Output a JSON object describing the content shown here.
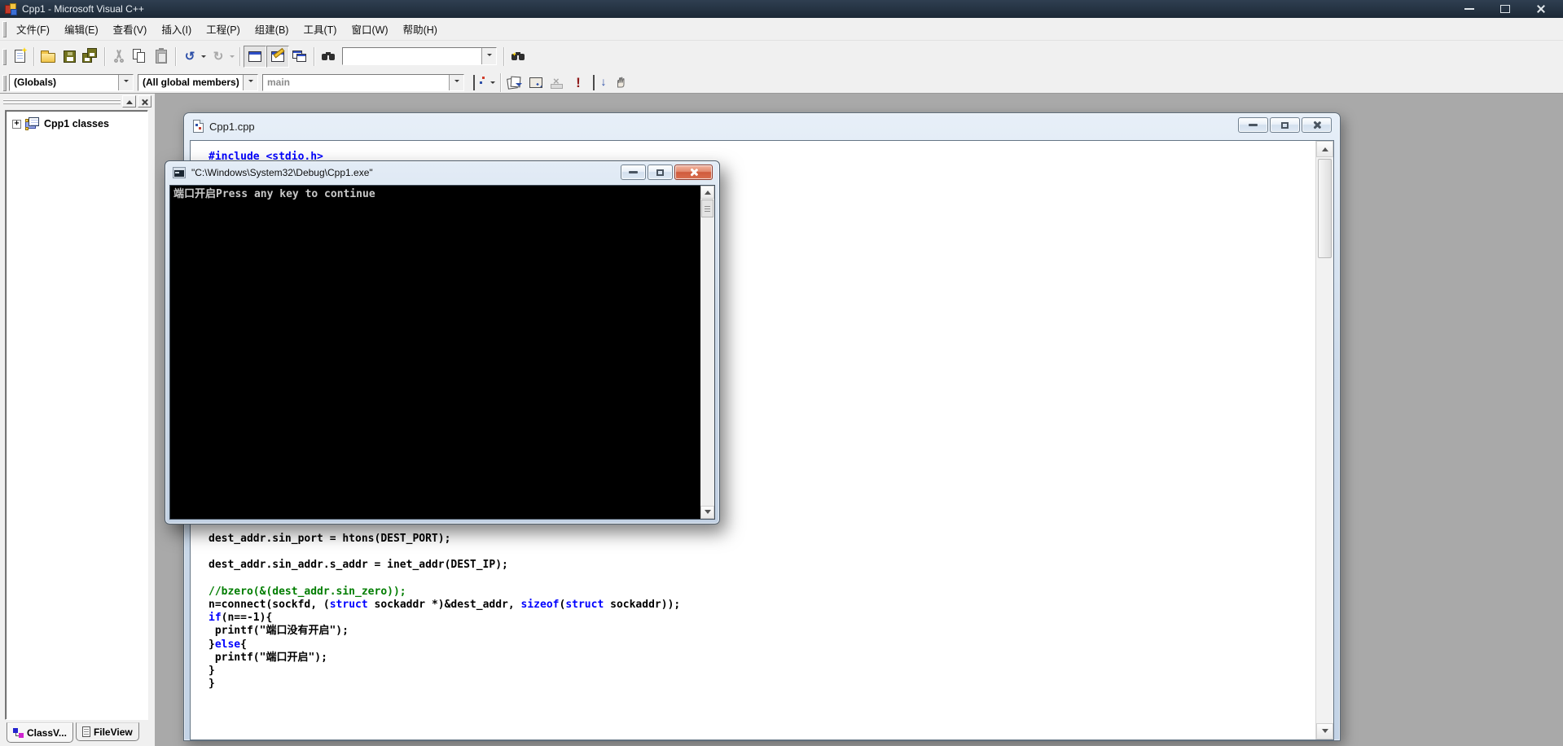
{
  "window": {
    "title": "Cpp1 - Microsoft Visual C++"
  },
  "menu": {
    "items": [
      "文件(F)",
      "编辑(E)",
      "查看(V)",
      "插入(I)",
      "工程(P)",
      "组建(B)",
      "工具(T)",
      "窗口(W)",
      "帮助(H)"
    ]
  },
  "toolbars": {
    "find_value": "",
    "wizard": {
      "scope": "(Globals)",
      "members": "(All global members)",
      "function": "main"
    }
  },
  "icons": {
    "undo": "↺",
    "redo": "↻",
    "execute": "!",
    "go_arrow": "↓",
    "expander_plus": "+",
    "stop_x": "×"
  },
  "workspace": {
    "root_label": "Cpp1 classes",
    "tabs": [
      {
        "label": "ClassV..."
      },
      {
        "label": "FileView"
      }
    ]
  },
  "editor": {
    "title": "Cpp1.cpp",
    "code_top": [
      [
        [
          "kw",
          "#include <stdio.h>"
        ]
      ]
    ],
    "code_bottom": [
      [
        [
          "plain",
          "dest_addr.sin_port = htons(DEST_PORT);"
        ]
      ],
      [],
      [
        [
          "plain",
          "dest_addr.sin_addr.s_addr = inet_addr(DEST_IP);"
        ]
      ],
      [],
      [
        [
          "com",
          "//bzero(&(dest_addr.sin_zero));"
        ]
      ],
      [
        [
          "plain",
          "n=connect(sockfd, ("
        ],
        [
          "kw",
          "struct"
        ],
        [
          "plain",
          " sockaddr *)&dest_addr, "
        ],
        [
          "kw",
          "sizeof"
        ],
        [
          "plain",
          "("
        ],
        [
          "kw",
          "struct"
        ],
        [
          "plain",
          " sockaddr));"
        ]
      ],
      [
        [
          "kw",
          "if"
        ],
        [
          "plain",
          "(n==-1){"
        ]
      ],
      [
        [
          "plain",
          " printf(\"端口没有开启\");"
        ]
      ],
      [
        [
          "plain",
          "}"
        ],
        [
          "kw",
          "else"
        ],
        [
          "plain",
          "{"
        ]
      ],
      [
        [
          "plain",
          " printf(\"端口开启\");"
        ]
      ],
      [
        [
          "plain",
          "}"
        ]
      ],
      [
        [
          "plain",
          "}"
        ]
      ]
    ]
  },
  "console": {
    "title": "\"C:\\Windows\\System32\\Debug\\Cpp1.exe\"",
    "output": "端口开启Press any key to continue"
  },
  "colors": {
    "keyword": "#0000ff",
    "comment": "#007d00",
    "console_text": "#c8c8c8",
    "mdi_background": "#a9a9a9",
    "title_bar": "#22303e"
  }
}
